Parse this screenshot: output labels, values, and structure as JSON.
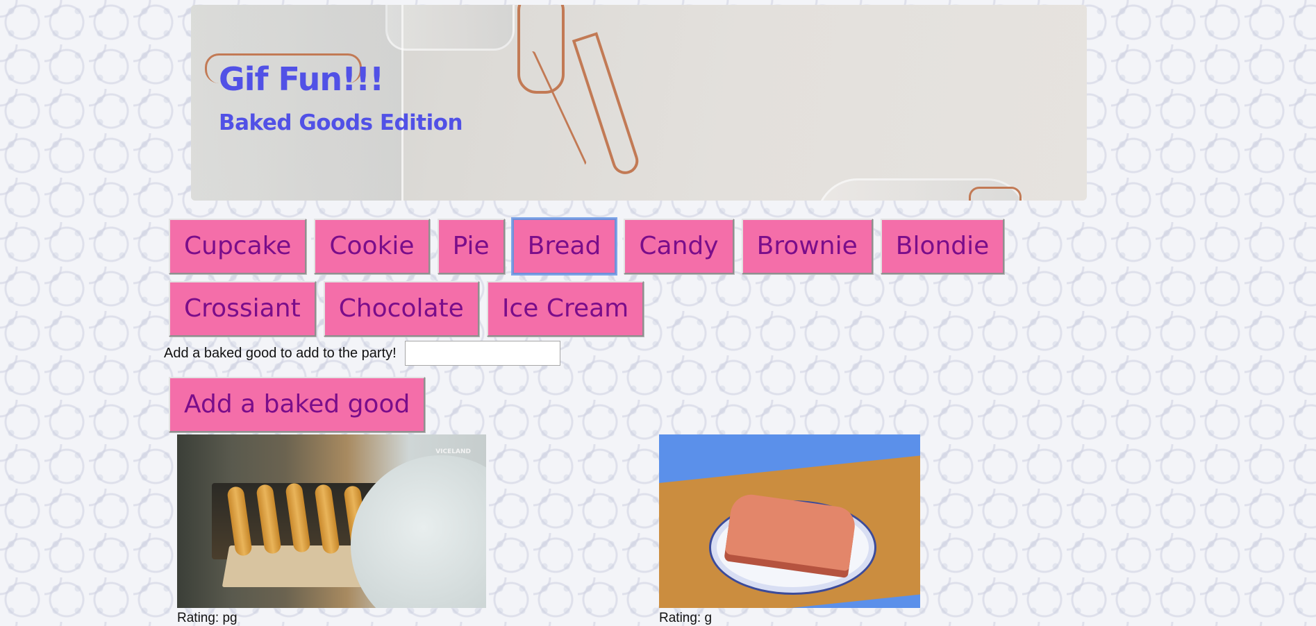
{
  "header": {
    "title": "Gif Fun!!!",
    "subtitle": "Baked Goods Edition"
  },
  "buttons": [
    {
      "label": "Cupcake"
    },
    {
      "label": "Cookie"
    },
    {
      "label": "Pie"
    },
    {
      "label": "Bread",
      "focused": true
    },
    {
      "label": "Candy"
    },
    {
      "label": "Brownie"
    },
    {
      "label": "Blondie"
    },
    {
      "label": "Crossiant"
    },
    {
      "label": "Chocolate"
    },
    {
      "label": "Ice Cream"
    }
  ],
  "add_form": {
    "label": "Add a baked good to add to the party!",
    "input_value": "",
    "button_label": "Add a baked good"
  },
  "gifs": [
    {
      "rating": "Rating: pg",
      "watermark": "VICELAND"
    },
    {
      "rating": "Rating: g"
    }
  ],
  "colors": {
    "button_bg": "#f46ea9",
    "button_text": "#7a0d8a",
    "title": "#5151e6"
  }
}
